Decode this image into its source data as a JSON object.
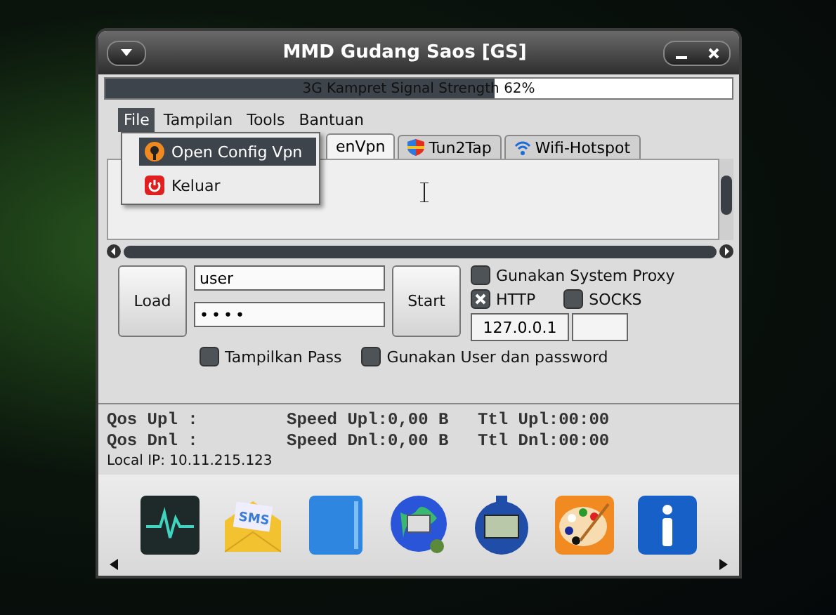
{
  "window": {
    "title": "MMD Gudang Saos [GS]"
  },
  "signal": {
    "label": "3G Kampret Signal Strength 62%",
    "level": 0.62
  },
  "menubar": [
    {
      "label": "File",
      "selected": true
    },
    {
      "label": "Tampilan",
      "selected": false
    },
    {
      "label": "Tools",
      "selected": false
    },
    {
      "label": "Bantuan",
      "selected": false
    }
  ],
  "file_menu": [
    {
      "label": "Open Config Vpn",
      "selected": true
    },
    {
      "label": "Keluar",
      "selected": false
    }
  ],
  "tabs": [
    {
      "label": "enVpn",
      "selected": true
    },
    {
      "label": "Tun2Tap",
      "selected": false
    },
    {
      "label": "Wifi-Hotspot",
      "selected": false
    }
  ],
  "controls": {
    "load": "Load",
    "start": "Start",
    "username": "user",
    "password": "••••",
    "proxy_host": "127.0.0.1"
  },
  "options": [
    {
      "label": "Gunakan System Proxy",
      "checked": false
    },
    {
      "label": "HTTP",
      "checked": true
    },
    {
      "label": "SOCKS",
      "checked": false
    },
    {
      "label": "Tampilkan Pass",
      "checked": false
    },
    {
      "label": "Gunakan User dan password",
      "checked": false
    }
  ],
  "stats": [
    [
      "Qos Upl :",
      "Speed Upl:0,00 B",
      "Ttl Upl:00:00"
    ],
    [
      "Qos Dnl :",
      "Speed Dnl:0,00 B",
      "Ttl Dnl:00:00"
    ]
  ],
  "local_ip": "Local IP: 10.11.215.123",
  "dock_icons": [
    {
      "kind": "monitor"
    },
    {
      "kind": "sms",
      "label": "SMS"
    },
    {
      "kind": "folder"
    },
    {
      "kind": "globe"
    },
    {
      "kind": "stopwatch"
    },
    {
      "kind": "palette"
    },
    {
      "kind": "info"
    }
  ]
}
